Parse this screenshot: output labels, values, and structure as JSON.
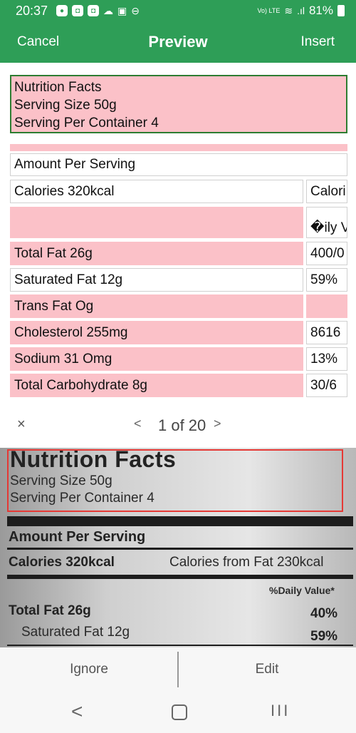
{
  "status_bar": {
    "time": "20:37",
    "app_icons": [
      "chat-icon",
      "app-icon-1",
      "app-icon-2",
      "weather-icon",
      "image-icon",
      "dnd-icon"
    ],
    "lte_label": "Vo) LTE",
    "battery": "81%"
  },
  "header": {
    "cancel": "Cancel",
    "title": "Preview",
    "insert": "Insert"
  },
  "preview": {
    "nutrition_box": {
      "line1": "Nutrition Facts",
      "line2": "Serving Size 50g",
      "line3": "Serving Per Container 4"
    },
    "rows": [
      {
        "left": "Amount Per Serving",
        "right": ""
      },
      {
        "left": "Calories 320kcal",
        "right": "Calori"
      },
      {
        "left": "",
        "right": "�ily V"
      },
      {
        "left": "Total Fat 26g",
        "right": "400/0"
      },
      {
        "left": "Saturated Fat 12g",
        "right": "59%"
      },
      {
        "left": "Trans Fat Og",
        "right": ""
      },
      {
        "left": "Cholesterol 255mg",
        "right": "8616"
      },
      {
        "left": "Sodium 31 Omg",
        "right": "13%"
      },
      {
        "left": "Total Carbohydrate 8g",
        "right": "30/6"
      }
    ]
  },
  "pager": {
    "close": "×",
    "prev": "<",
    "label": "1 of 20",
    "next": ">"
  },
  "photo": {
    "title": "Nutrition Facts",
    "serving_size": "Serving Size 50g",
    "serving_per_container": "Serving Per Container 4",
    "amount_per_serving": "Amount Per Serving",
    "calories": "Calories 320kcal",
    "calories_from_fat": "Calories from Fat 230kcal",
    "daily_value": "%Daily Value*",
    "total_fat": "Total Fat 26g",
    "total_fat_pct": "40%",
    "saturated_fat": "Saturated Fat 12g",
    "saturated_fat_pct": "59%",
    "highlight_color": "#e53935"
  },
  "actions": {
    "ignore": "Ignore",
    "edit": "Edit"
  },
  "navbar": {
    "back": "<",
    "recent": "III"
  },
  "colors": {
    "accent": "#2e9e57",
    "highlight_pink": "#fbc1c8",
    "border_green": "#2e7d32"
  }
}
